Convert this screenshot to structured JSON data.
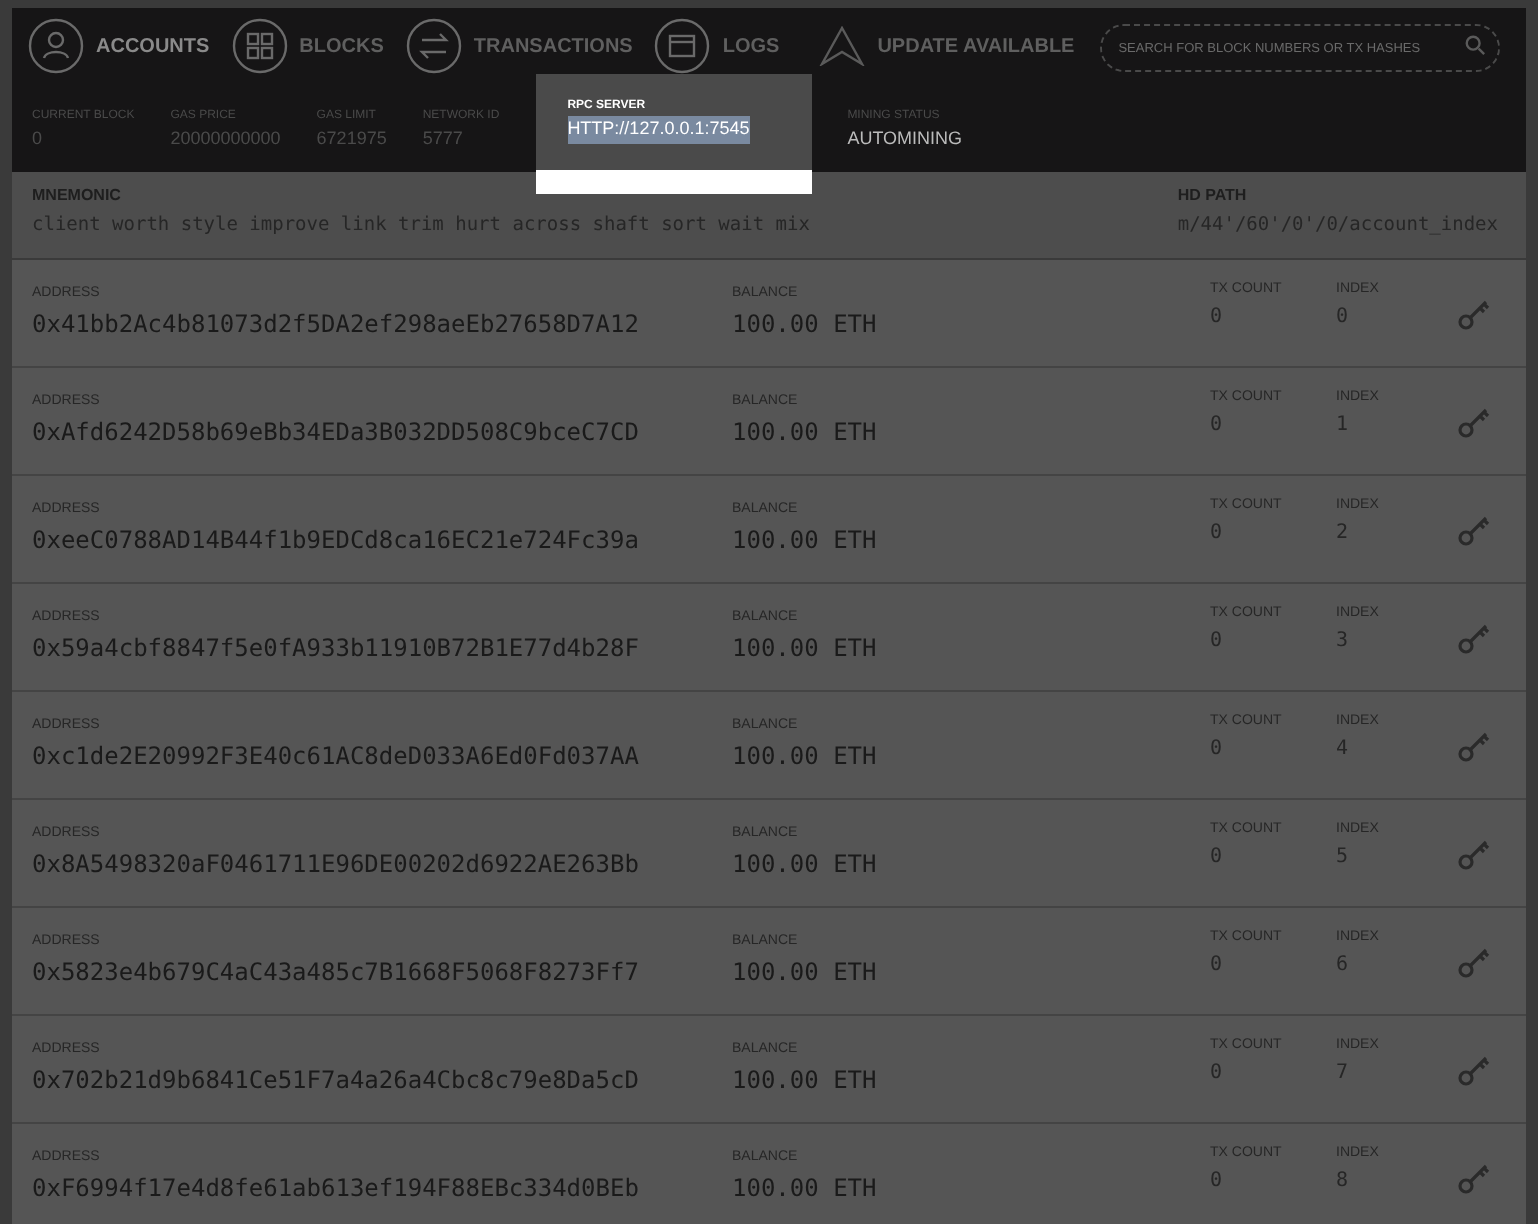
{
  "nav": [
    {
      "label": "ACCOUNTS",
      "kind": "user",
      "selected": true
    },
    {
      "label": "BLOCKS",
      "kind": "blocks",
      "selected": false
    },
    {
      "label": "TRANSACTIONS",
      "kind": "swap",
      "selected": false
    },
    {
      "label": "LOGS",
      "kind": "logs",
      "selected": false
    }
  ],
  "update": "UPDATE AVAILABLE",
  "search": {
    "placeholder": "SEARCH FOR BLOCK NUMBERS OR TX HASHES"
  },
  "stats": [
    {
      "label": "CURRENT BLOCK",
      "value": "0",
      "highlighted": false
    },
    {
      "label": "GAS PRICE",
      "value": "20000000000",
      "highlighted": false
    },
    {
      "label": "GAS LIMIT",
      "value": "6721975",
      "highlighted": false
    },
    {
      "label": "NETWORK ID",
      "value": "5777",
      "highlighted": false
    },
    {
      "label": "RPC SERVER",
      "value": "HTTP://127.0.0.1:7545",
      "highlighted": true
    },
    {
      "label": "MINING STATUS",
      "value": "AUTOMINING",
      "highlighted": false
    }
  ],
  "mnemonic": {
    "label": "MNEMONIC",
    "words": "client worth style improve link trim hurt across shaft sort wait mix"
  },
  "hd_path": {
    "label": "HD PATH",
    "value": "m/44'/60'/0'/0/account_index"
  },
  "accounts": [
    {
      "address_label": "ADDRESS",
      "address": "0x41bb2Ac4b81073d2f5DA2ef298aeEb27658D7A12",
      "balance_label": "BALANCE",
      "balance": "100.00 ETH",
      "tx_count_label": "TX COUNT",
      "tx_count": "0",
      "index_label": "INDEX",
      "index": "0"
    },
    {
      "address_label": "ADDRESS",
      "address": "0xAfd6242D58b69eBb34EDa3B032DD508C9bceC7CD",
      "balance_label": "BALANCE",
      "balance": "100.00 ETH",
      "tx_count_label": "TX COUNT",
      "tx_count": "0",
      "index_label": "INDEX",
      "index": "1"
    },
    {
      "address_label": "ADDRESS",
      "address": "0xeeC0788AD14B44f1b9EDCd8ca16EC21e724Fc39a",
      "balance_label": "BALANCE",
      "balance": "100.00 ETH",
      "tx_count_label": "TX COUNT",
      "tx_count": "0",
      "index_label": "INDEX",
      "index": "2"
    },
    {
      "address_label": "ADDRESS",
      "address": "0x59a4cbf8847f5e0fA933b11910B72B1E77d4b28F",
      "balance_label": "BALANCE",
      "balance": "100.00 ETH",
      "tx_count_label": "TX COUNT",
      "tx_count": "0",
      "index_label": "INDEX",
      "index": "3"
    },
    {
      "address_label": "ADDRESS",
      "address": "0xc1de2E20992F3E40c61AC8deD033A6Ed0Fd037AA",
      "balance_label": "BALANCE",
      "balance": "100.00 ETH",
      "tx_count_label": "TX COUNT",
      "tx_count": "0",
      "index_label": "INDEX",
      "index": "4"
    },
    {
      "address_label": "ADDRESS",
      "address": "0x8A5498320aF0461711E96DE00202d6922AE263Bb",
      "balance_label": "BALANCE",
      "balance": "100.00 ETH",
      "tx_count_label": "TX COUNT",
      "tx_count": "0",
      "index_label": "INDEX",
      "index": "5"
    },
    {
      "address_label": "ADDRESS",
      "address": "0x5823e4b679C4aC43a485c7B1668F5068F8273Ff7",
      "balance_label": "BALANCE",
      "balance": "100.00 ETH",
      "tx_count_label": "TX COUNT",
      "tx_count": "0",
      "index_label": "INDEX",
      "index": "6"
    },
    {
      "address_label": "ADDRESS",
      "address": "0x702b21d9b6841Ce51F7a4a26a4Cbc8c79e8Da5cD",
      "balance_label": "BALANCE",
      "balance": "100.00 ETH",
      "tx_count_label": "TX COUNT",
      "tx_count": "0",
      "index_label": "INDEX",
      "index": "7"
    },
    {
      "address_label": "ADDRESS",
      "address": "0xF6994f17e4d8fe61ab613ef194F88EBc334d0BEb",
      "balance_label": "BALANCE",
      "balance": "100.00 ETH",
      "tx_count_label": "TX COUNT",
      "tx_count": "0",
      "index_label": "INDEX",
      "index": "8"
    }
  ]
}
